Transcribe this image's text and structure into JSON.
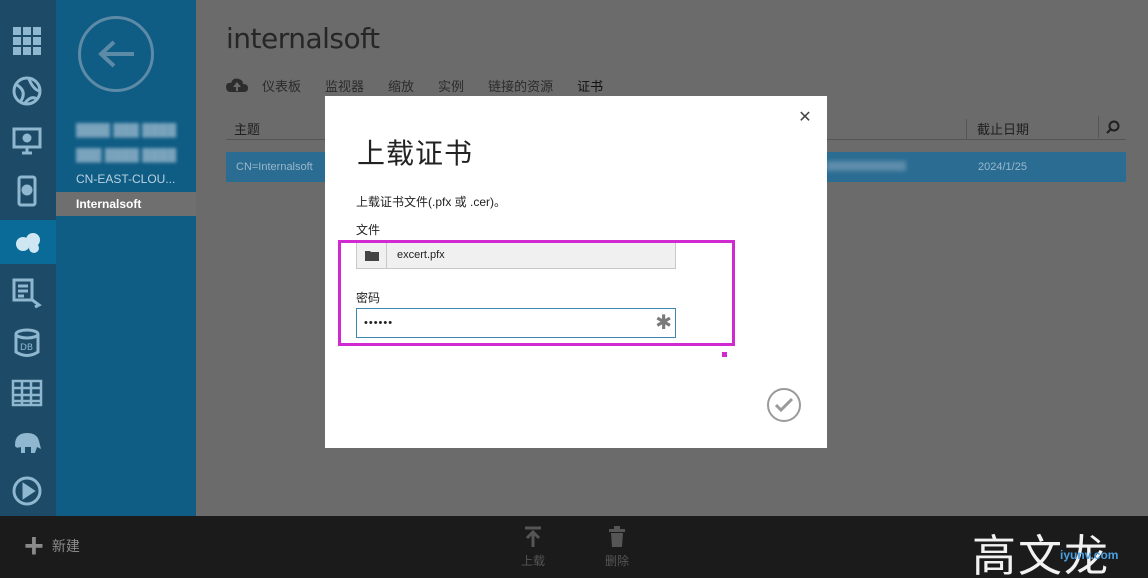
{
  "nav": {
    "items": [
      {
        "label": "████ ███ ████"
      },
      {
        "label": "███ ████ ████"
      },
      {
        "label": "CN-EAST-CLOU..."
      },
      {
        "label": "Internalsoft"
      }
    ]
  },
  "main": {
    "title": "internalsoft",
    "tabs": [
      "仪表板",
      "监视器",
      "缩放",
      "实例",
      "链接的资源",
      "证书"
    ],
    "active_tab": "证书",
    "grid": {
      "columns": [
        "主题",
        "截止日期"
      ],
      "row": {
        "subject": "CN=Internalsoft",
        "expiry": "2024/1/25"
      }
    }
  },
  "dialog": {
    "title": "上载证书",
    "description": "上载证书文件(.pfx 或 .cer)。",
    "file_label": "文件",
    "file_value": "excert.pfx",
    "password_label": "密码",
    "password_value": "••••••"
  },
  "bottom_bar": {
    "new_label": "新建",
    "upload_label": "上载",
    "delete_label": "删除"
  },
  "watermark": {
    "text": "高文龙",
    "site": "iyunv.com"
  },
  "colors": {
    "highlight": "#d02ad0",
    "nav_bg": "#0f5c84",
    "rail_bg": "#1d4a66",
    "active_row": "#2a6c92"
  },
  "icons": [
    "grid-apps-icon",
    "globe-icon",
    "monitor-icon",
    "mobile-icon",
    "cloud-services-icon",
    "documents-icon",
    "database-icon",
    "table-icon",
    "elephant-icon",
    "media-icon",
    "back-arrow-icon",
    "cloud-upload-icon",
    "search-icon",
    "folder-icon",
    "asterisk-icon",
    "check-icon",
    "close-icon",
    "plus-icon",
    "upload-icon",
    "trash-icon"
  ]
}
